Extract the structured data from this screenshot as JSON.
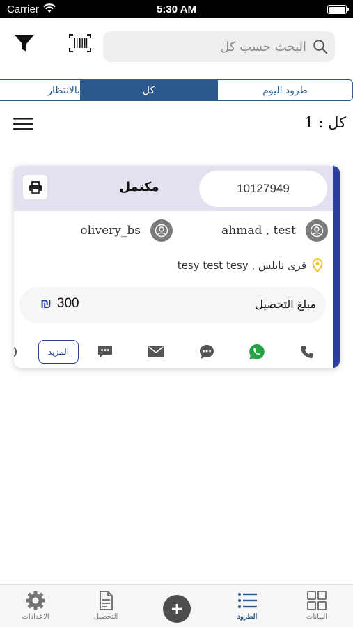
{
  "status_bar": {
    "carrier": "Carrier",
    "time": "5:30 AM"
  },
  "toolbar": {
    "search_placeholder": "البحث حسب كل"
  },
  "tabs": [
    {
      "label": "طرود اليوم",
      "active": false
    },
    {
      "label": "كل",
      "active": true
    },
    {
      "label": "بالانتظار",
      "active": false
    }
  ],
  "count": {
    "label": "كل : 1"
  },
  "parcel": {
    "tracking_number": "10127949",
    "status": "مكتمل",
    "receiver_name": "ahmad , test",
    "sender_name": "olivery_bs",
    "address": "قرى نابلس , tesy test tesy",
    "amount_label": "مبلغ التحصيل",
    "amount_value": "300",
    "currency_symbol": "₪",
    "more_label": "المزيد"
  },
  "bottom_nav": [
    {
      "label": "البيانات",
      "icon": "grid-icon",
      "active": false
    },
    {
      "label": "الطرود",
      "icon": "list-icon",
      "active": true
    },
    {
      "label": "",
      "icon": "add-icon",
      "active": false
    },
    {
      "label": "التحصيل",
      "icon": "document-icon",
      "active": false
    },
    {
      "label": "الاعدادات",
      "icon": "gear-icon",
      "active": false
    }
  ],
  "colors": {
    "primary": "#2d5a8e",
    "accent": "#2b3ea0",
    "card_header": "#e1e1ef",
    "whatsapp": "#25a244",
    "pin": "#f2c21b"
  }
}
